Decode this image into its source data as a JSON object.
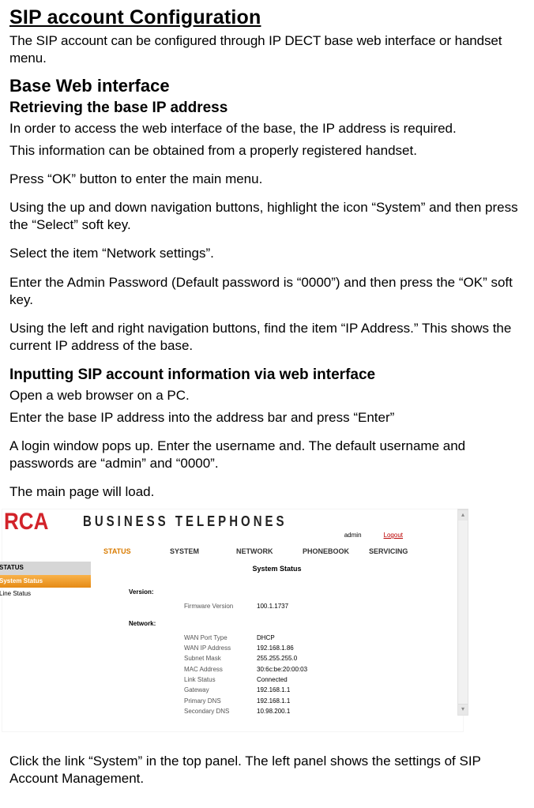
{
  "title": "SIP account Configuration   ",
  "intro": "The SIP account can be configured through IP DECT base web interface or handset menu.",
  "h2_base": "Base  Web  interface",
  "h3_retrieve": "Retrieving the base IP address",
  "p1": "In order to access the web interface of the base, the IP address is required.",
  "p2": "This information can be obtained from a properly registered handset.",
  "p3": "Press “OK” button to enter the main menu.",
  "p4": "Using the up and down navigation buttons, highlight the icon “System” and then press the “Select” soft key.",
  "p5": "Select the item “Network settings”.",
  "p6": "Enter the Admin Password (Default password is “0000”) and then press the “OK” soft key.",
  "p7": "Using the left and right navigation buttons, find the item “IP Address.”   This shows the current IP address of the base.",
  "h3_input": "Inputting SIP account information via web interface",
  "p8": "Open a web browser on a PC.",
  "p9": "Enter the base IP address into the address bar and press “Enter”",
  "p10": "A login window pops up. Enter the username and.  The default username and passwords are “admin” and “0000”.",
  "p11": "The main page will load.",
  "p12": "Click the link “System” in the top panel. The left panel shows the settings of SIP Account  Management.",
  "shot": {
    "brand": "RCA",
    "brand_sub": "BUSINESS TELEPHONES",
    "admin": "admin",
    "logout": "Logout",
    "nav": [
      "STATUS",
      "SYSTEM",
      "NETWORK",
      "PHONEBOOK",
      "SERVICING"
    ],
    "sidebar_head": "STATUS",
    "sidebar_items": [
      "System Status",
      "Line Status"
    ],
    "content_title": "System Status",
    "section_version": "Version:",
    "fw_key": "Firmware Version",
    "fw_val": "100.1.1737",
    "section_network": "Network:",
    "net": [
      {
        "k": "WAN Port Type",
        "v": "DHCP"
      },
      {
        "k": "WAN IP Address",
        "v": "192.168.1.86"
      },
      {
        "k": "Subnet Mask",
        "v": "255.255.255.0"
      },
      {
        "k": "MAC Address",
        "v": "30:6c:be:20:00:03"
      },
      {
        "k": "Link Status",
        "v": "Connected"
      },
      {
        "k": "Gateway",
        "v": "192.168.1.1"
      },
      {
        "k": "Primary DNS",
        "v": "192.168.1.1"
      },
      {
        "k": "Secondary DNS",
        "v": "10.98.200.1"
      }
    ]
  }
}
